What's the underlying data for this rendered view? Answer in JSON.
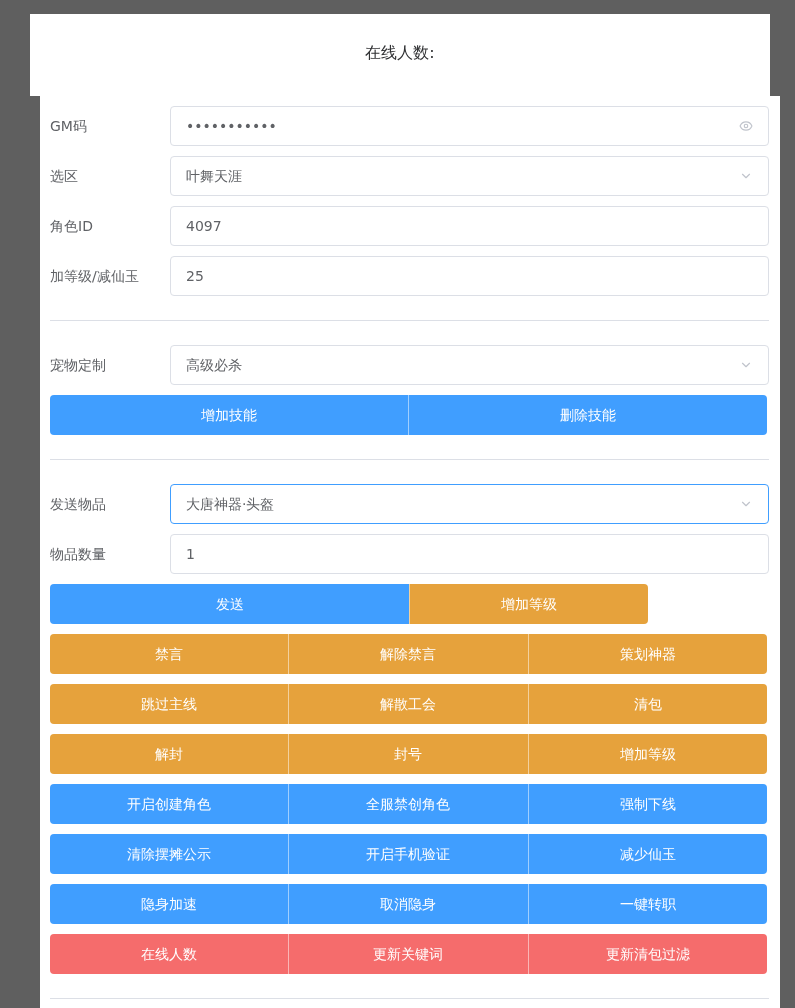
{
  "header": {
    "title": "在线人数:"
  },
  "sections": [
    {
      "fields": [
        {
          "label": "GM码",
          "kind": "password",
          "value": "•••••••••••",
          "focused": false
        },
        {
          "label": "选区",
          "kind": "select",
          "value": "叶舞天涯",
          "focused": false
        },
        {
          "label": "角色ID",
          "kind": "text",
          "value": "4097",
          "focused": false
        },
        {
          "label": "加等级/减仙玉",
          "kind": "text",
          "value": "25",
          "focused": false
        }
      ]
    },
    {
      "fields": [
        {
          "label": "宠物定制",
          "kind": "select",
          "value": "高级必杀",
          "focused": false
        }
      ],
      "button_rows": [
        {
          "kind": "full",
          "buttons": [
            {
              "label": "增加技能",
              "color": "#409eff"
            },
            {
              "label": "删除技能",
              "color": "#409eff"
            }
          ]
        }
      ]
    },
    {
      "fields": [
        {
          "label": "发送物品",
          "kind": "select",
          "value": "大唐神器·头盔",
          "focused": true
        },
        {
          "label": "物品数量",
          "kind": "text",
          "value": "1",
          "focused": false
        }
      ],
      "button_rows": [
        {
          "kind": "partial",
          "buttons": [
            {
              "label": "发送",
              "color": "#409eff"
            },
            {
              "label": "增加等级",
              "color": "#e6a23c"
            }
          ]
        },
        {
          "kind": "full",
          "buttons": [
            {
              "label": "禁言",
              "color": "#e6a23c"
            },
            {
              "label": "解除禁言",
              "color": "#e6a23c"
            },
            {
              "label": "策划神器",
              "color": "#e6a23c"
            }
          ]
        },
        {
          "kind": "full",
          "buttons": [
            {
              "label": "跳过主线",
              "color": "#e6a23c"
            },
            {
              "label": "解散工会",
              "color": "#e6a23c"
            },
            {
              "label": "清包",
              "color": "#e6a23c"
            }
          ]
        },
        {
          "kind": "full",
          "buttons": [
            {
              "label": "解封",
              "color": "#e6a23c"
            },
            {
              "label": "封号",
              "color": "#e6a23c"
            },
            {
              "label": "增加等级",
              "color": "#e6a23c"
            }
          ]
        },
        {
          "kind": "full",
          "buttons": [
            {
              "label": "开启创建角色",
              "color": "#409eff"
            },
            {
              "label": "全服禁创角色",
              "color": "#409eff"
            },
            {
              "label": "强制下线",
              "color": "#409eff"
            }
          ]
        },
        {
          "kind": "full",
          "buttons": [
            {
              "label": "清除摆摊公示",
              "color": "#409eff"
            },
            {
              "label": "开启手机验证",
              "color": "#409eff"
            },
            {
              "label": "减少仙玉",
              "color": "#409eff"
            }
          ]
        },
        {
          "kind": "full",
          "buttons": [
            {
              "label": "隐身加速",
              "color": "#409eff"
            },
            {
              "label": "取消隐身",
              "color": "#409eff"
            },
            {
              "label": "一键转职",
              "color": "#409eff"
            }
          ]
        },
        {
          "kind": "full",
          "buttons": [
            {
              "label": "在线人数",
              "color": "#f56c6c"
            },
            {
              "label": "更新关键词",
              "color": "#f56c6c"
            },
            {
              "label": "更新清包过滤",
              "color": "#f56c6c"
            }
          ]
        }
      ]
    }
  ]
}
